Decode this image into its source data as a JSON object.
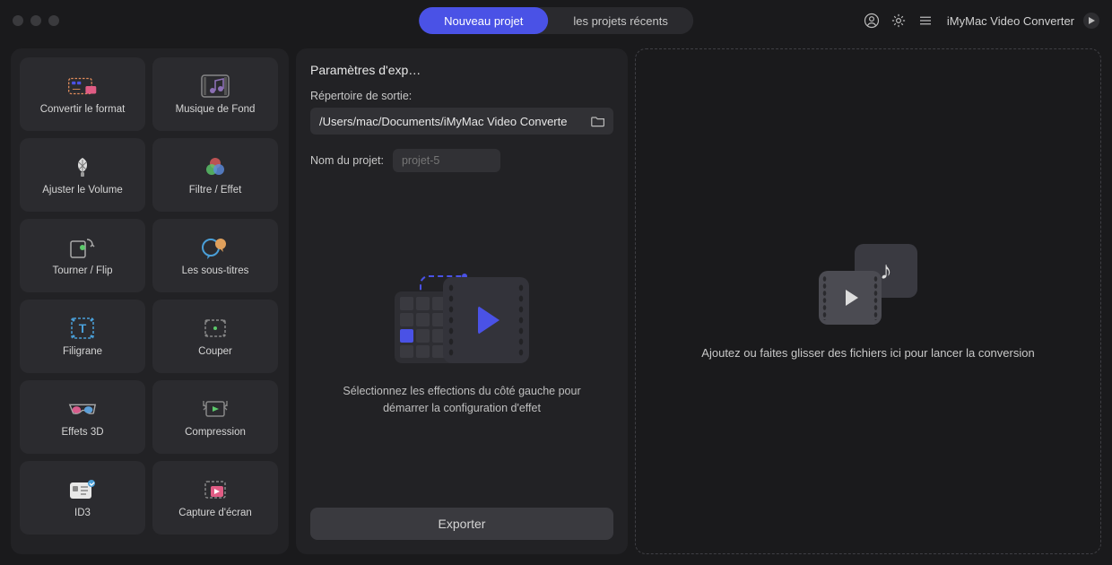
{
  "header": {
    "tab_new": "Nouveau projet",
    "tab_recent": "les projets récents",
    "app_title": "iMyMac Video Converter"
  },
  "sidebar": {
    "tools": [
      {
        "label": "Convertir le format"
      },
      {
        "label": "Musique de Fond"
      },
      {
        "label": "Ajuster le Volume"
      },
      {
        "label": "Filtre / Effet"
      },
      {
        "label": "Tourner / Flip"
      },
      {
        "label": "Les sous-titres"
      },
      {
        "label": "Filigrane"
      },
      {
        "label": "Couper"
      },
      {
        "label": "Effets 3D"
      },
      {
        "label": "Compression"
      },
      {
        "label": "ID3"
      },
      {
        "label": "Capture d'écran"
      }
    ]
  },
  "middle": {
    "section_title": "Paramètres d'exp…",
    "outdir_label": "Répertoire de sortie:",
    "outdir_value": "/Users/mac/Documents/iMyMac Video Converte",
    "projname_label": "Nom du projet:",
    "projname_placeholder": "projet-5",
    "illus_text": "Sélectionnez les effections du côté gauche pour démarrer la configuration d'effet",
    "export_label": "Exporter"
  },
  "dropzone": {
    "text": "Ajoutez ou faites glisser des fichiers ici pour lancer la conversion"
  }
}
